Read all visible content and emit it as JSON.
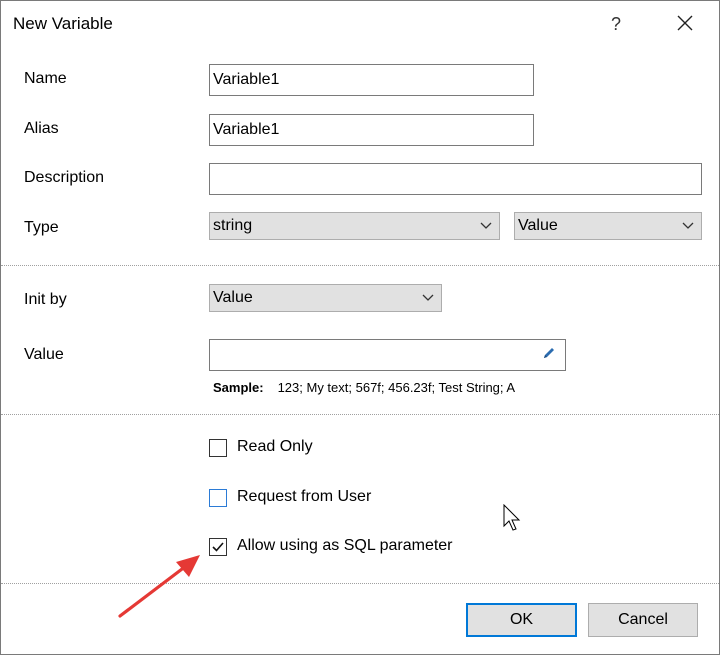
{
  "window": {
    "title": "New Variable",
    "help_glyph": "?"
  },
  "fields": {
    "name_label": "Name",
    "name_value": "Variable1",
    "alias_label": "Alias",
    "alias_value": "Variable1",
    "description_label": "Description",
    "description_value": "",
    "type_label": "Type",
    "type_value": "string",
    "type_kind_value": "Value",
    "init_by_label": "Init by",
    "init_by_value": "Value",
    "value_label": "Value",
    "value_value": "",
    "sample_label": "Sample:",
    "sample_text": "123; My text; 567f; 456.23f; Test String; A"
  },
  "options": {
    "read_only": {
      "label": "Read Only",
      "checked": false
    },
    "request_from_user": {
      "label": "Request from User",
      "checked": false
    },
    "allow_sql": {
      "label": "Allow using as SQL parameter",
      "checked": true
    }
  },
  "buttons": {
    "ok": "OK",
    "cancel": "Cancel"
  },
  "colors": {
    "accent": "#0078d7",
    "annotation_arrow": "#e53935",
    "combo_bg": "#e1e1e1"
  },
  "icons": {
    "close": "close-icon",
    "edit": "pencil-icon",
    "chevron": "chevron-down-icon",
    "check": "checkmark-icon"
  }
}
